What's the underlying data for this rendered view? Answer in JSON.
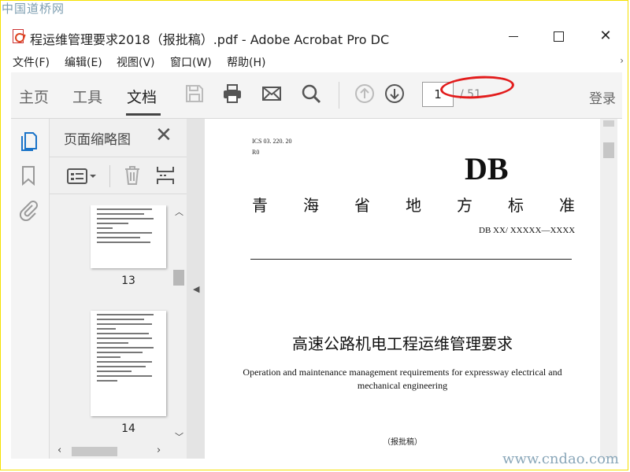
{
  "watermark": {
    "top": "中国道桥网",
    "bottom": "www.cndao.com"
  },
  "window": {
    "title": "程运维管理要求2018（报批稿）.pdf - Adobe Acrobat Pro DC"
  },
  "menu": [
    "文件(F)",
    "编辑(E)",
    "视图(V)",
    "窗口(W)",
    "帮助(H)"
  ],
  "toolbar": {
    "tabs": [
      "主页",
      "工具",
      "文档"
    ],
    "current_page": "1",
    "total_pages": "/ 51",
    "login_label": "登录"
  },
  "panel": {
    "title": "页面缩略图",
    "thumbnails": [
      {
        "page": "13"
      },
      {
        "page": "14"
      }
    ]
  },
  "document": {
    "ics": "ICS  03. 220. 20",
    "r0": "R0",
    "db_mark": "DB",
    "std_title_chars": [
      "青",
      "海",
      "省",
      "地",
      "方",
      "标",
      "准"
    ],
    "db_number": "DB XX/  XXXXX—XXXX",
    "main_title": "高速公路机电工程运维管理要求",
    "en_title": "Operation and maintenance management requirements for expressway electrical and mechanical engineering",
    "draft": "（报批稿）"
  },
  "colors": {
    "highlight_oval": "#e21c1c",
    "frame": "#f5e100"
  }
}
